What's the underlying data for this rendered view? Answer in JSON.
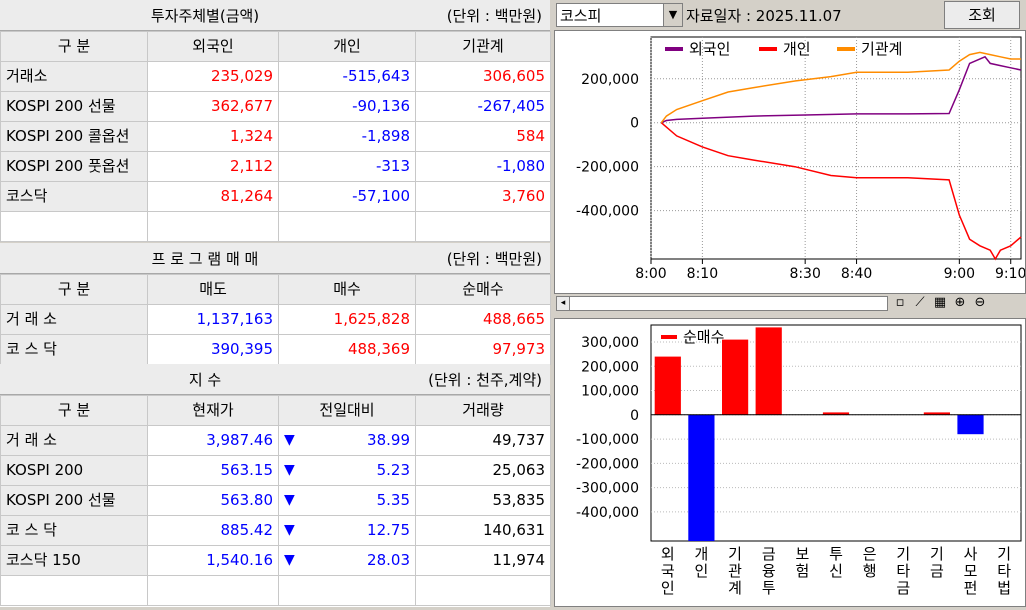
{
  "investor": {
    "title": "투자주체별(금액)",
    "unit": "(단위 : 백만원)",
    "headers": [
      "구 분",
      "외국인",
      "개인",
      "기관계"
    ],
    "rows": [
      {
        "label": "거래소",
        "v": [
          "235,029",
          "-515,643",
          "306,605"
        ]
      },
      {
        "label": "KOSPI 200 선물",
        "v": [
          "362,677",
          "-90,136",
          "-267,405"
        ]
      },
      {
        "label": "KOSPI 200 콜옵션",
        "v": [
          "1,324",
          "-1,898",
          "584"
        ]
      },
      {
        "label": "KOSPI 200 풋옵션",
        "v": [
          "2,112",
          "-313",
          "-1,080"
        ]
      },
      {
        "label": "코스닥",
        "v": [
          "81,264",
          "-57,100",
          "3,760"
        ]
      }
    ]
  },
  "program": {
    "title": "프 로 그 램 매 매",
    "unit": "(단위 : 백만원)",
    "headers": [
      "구 분",
      "매도",
      "매수",
      "순매수"
    ],
    "rows": [
      {
        "label": "거 래 소",
        "v": [
          "1,137,163",
          "1,625,828",
          "488,665"
        ]
      },
      {
        "label": "코 스 닥",
        "v": [
          "390,395",
          "488,369",
          "97,973"
        ]
      }
    ]
  },
  "index": {
    "title": "지 수",
    "unit": "(단위 : 천주,계약)",
    "headers": [
      "구 분",
      "현재가",
      "전일대비",
      "거래량"
    ],
    "rows": [
      {
        "label": "거 래 소",
        "price": "3,987.46",
        "change": "38.99",
        "volume": "49,737"
      },
      {
        "label": "KOSPI 200",
        "price": "563.15",
        "change": "5.23",
        "volume": "25,063"
      },
      {
        "label": "KOSPI 200 선물",
        "price": "563.80",
        "change": "5.35",
        "volume": "53,835"
      },
      {
        "label": "코 스 닥",
        "price": "885.42",
        "change": "12.75",
        "volume": "140,631"
      },
      {
        "label": "코스닥 150",
        "price": "1,540.16",
        "change": "28.03",
        "volume": "11,974"
      }
    ],
    "down_arrow": "▼"
  },
  "toolbar": {
    "market": "코스피",
    "date_label": "자료일자 : 2025.11.07",
    "query_button": "조회"
  },
  "colors": {
    "foreign": "#800080",
    "individual": "#ff0000",
    "institution": "#ff8c00",
    "positive": "#ff0000",
    "negative": "#0000ff"
  },
  "chart_data": [
    {
      "type": "line",
      "legend_placement": "top",
      "x_ticks": [
        "8:00",
        "8:10",
        "8:30",
        "8:40",
        "9:00",
        "9:10"
      ],
      "x_tick_minutes": [
        0,
        10,
        30,
        40,
        60,
        70
      ],
      "y_ticks": [
        200000,
        0,
        -200000,
        -400000
      ],
      "y_tick_labels": [
        "200,000",
        "0",
        "-200,000",
        "-400,000"
      ],
      "ylim": [
        -620000,
        390000
      ],
      "xlim_minutes": [
        0,
        72
      ],
      "grid": true,
      "series": [
        {
          "name": "외국인",
          "color": "#800080",
          "points": [
            [
              2,
              0
            ],
            [
              3,
              10000
            ],
            [
              5,
              15000
            ],
            [
              10,
              20000
            ],
            [
              20,
              30000
            ],
            [
              30,
              35000
            ],
            [
              40,
              40000
            ],
            [
              50,
              40000
            ],
            [
              58,
              42000
            ],
            [
              60,
              150000
            ],
            [
              62,
              270000
            ],
            [
              63,
              280000
            ],
            [
              65,
              300000
            ],
            [
              66,
              270000
            ],
            [
              68,
              260000
            ],
            [
              70,
              250000
            ],
            [
              72,
              240000
            ]
          ]
        },
        {
          "name": "개인",
          "color": "#ff0000",
          "points": [
            [
              2,
              0
            ],
            [
              3,
              -20000
            ],
            [
              5,
              -60000
            ],
            [
              10,
              -110000
            ],
            [
              15,
              -150000
            ],
            [
              20,
              -170000
            ],
            [
              28,
              -200000
            ],
            [
              35,
              -240000
            ],
            [
              40,
              -250000
            ],
            [
              50,
              -250000
            ],
            [
              58,
              -260000
            ],
            [
              60,
              -420000
            ],
            [
              62,
              -530000
            ],
            [
              64,
              -560000
            ],
            [
              66,
              -580000
            ],
            [
              67,
              -620000
            ],
            [
              68,
              -580000
            ],
            [
              70,
              -560000
            ],
            [
              72,
              -520000
            ]
          ]
        },
        {
          "name": "기관계",
          "color": "#ff8c00",
          "points": [
            [
              2,
              0
            ],
            [
              3,
              30000
            ],
            [
              5,
              60000
            ],
            [
              10,
              100000
            ],
            [
              15,
              140000
            ],
            [
              20,
              160000
            ],
            [
              28,
              190000
            ],
            [
              35,
              210000
            ],
            [
              40,
              230000
            ],
            [
              50,
              230000
            ],
            [
              58,
              240000
            ],
            [
              60,
              280000
            ],
            [
              62,
              310000
            ],
            [
              64,
              320000
            ],
            [
              66,
              310000
            ],
            [
              68,
              300000
            ],
            [
              70,
              290000
            ],
            [
              72,
              290000
            ]
          ]
        }
      ]
    },
    {
      "type": "bar",
      "legend_placement": "top-left",
      "series": [
        {
          "name": "순매수"
        }
      ],
      "categories": [
        "외국인",
        "개인",
        "기관계",
        "금융투",
        "보험",
        "투신",
        "은행",
        "기타금",
        "기금",
        "사모펀",
        "기타법"
      ],
      "values": [
        240000,
        -520000,
        310000,
        360000,
        0,
        10000,
        0,
        0,
        10000,
        -80000,
        0
      ],
      "y_ticks": [
        300000,
        200000,
        100000,
        0,
        -100000,
        -200000,
        -300000,
        -400000
      ],
      "y_tick_labels": [
        "300,000",
        "200,000",
        "100,000",
        "0",
        "-100,000",
        "-200,000",
        "-300,000",
        "-400,000"
      ],
      "ylim": [
        -520000,
        370000
      ],
      "grid": true
    }
  ]
}
